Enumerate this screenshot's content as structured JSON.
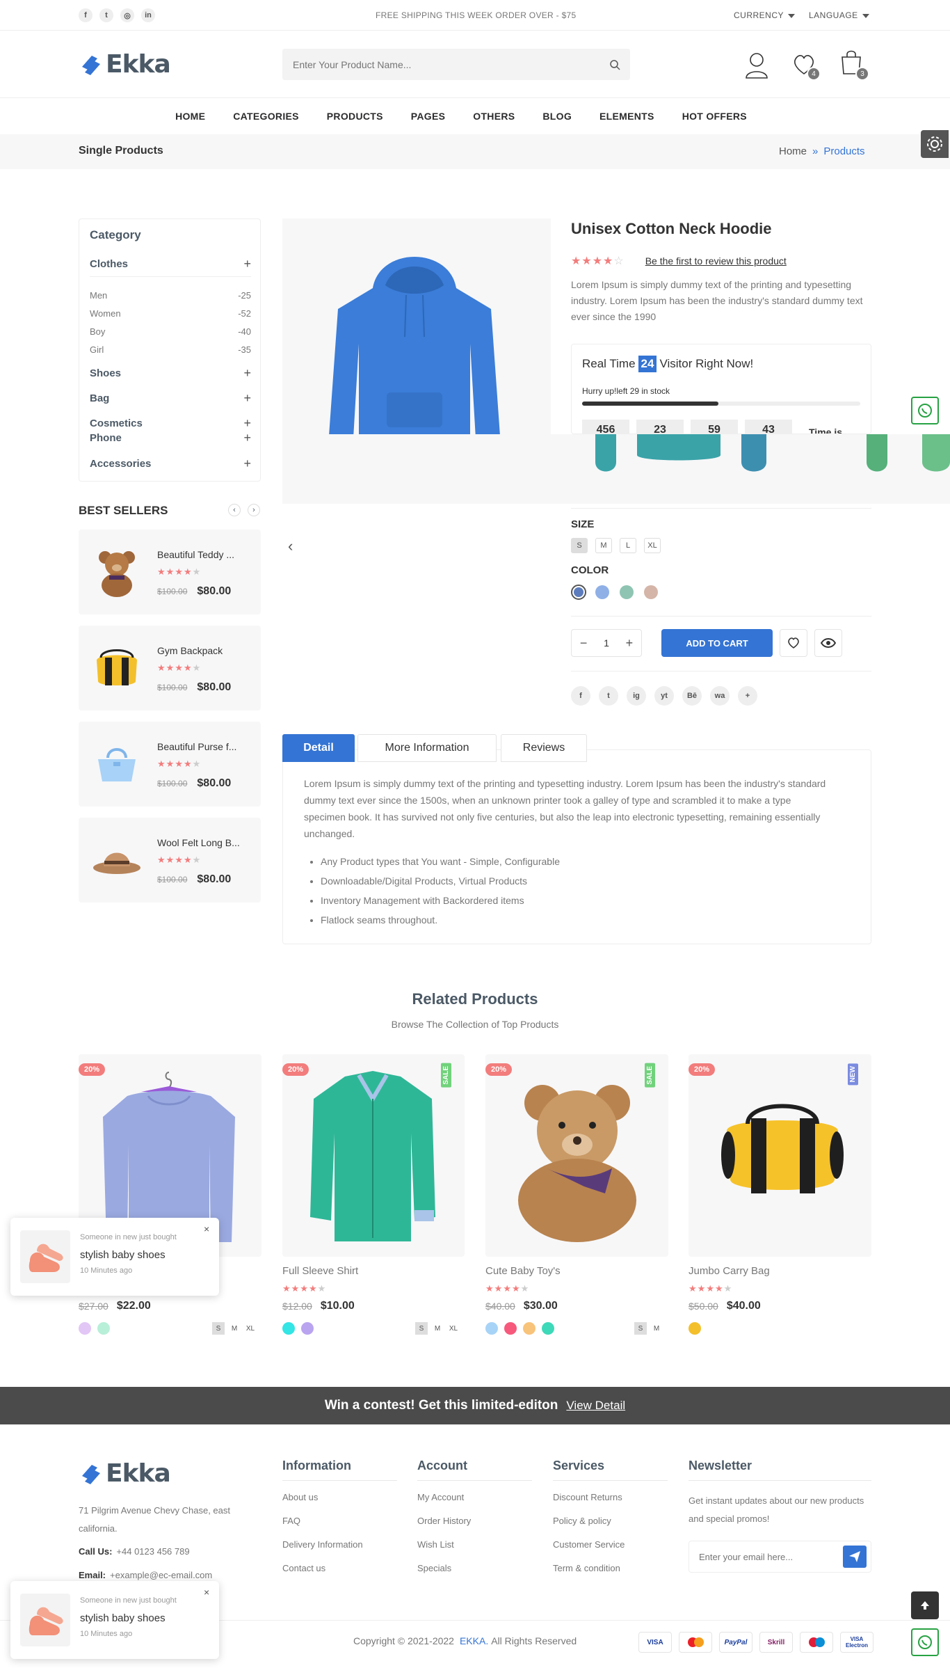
{
  "topbar": {
    "social_icons": [
      "facebook-icon",
      "twitter-icon",
      "instagram-icon",
      "linkedin-icon"
    ],
    "promo": "FREE SHIPPING THIS WEEK ORDER OVER - $75",
    "currency": "CURRENCY",
    "language": "LANGUAGE"
  },
  "header": {
    "logo": "Ekka",
    "search_placeholder": "Enter Your Product Name...",
    "wishlist_count": "4",
    "cart_count": "3"
  },
  "nav": [
    "HOME",
    "CATEGORIES",
    "PRODUCTS",
    "PAGES",
    "OTHERS",
    "BLOG",
    "ELEMENTS",
    "HOT OFFERS"
  ],
  "breadcrumb": {
    "title": "Single Products",
    "home": "Home",
    "current": "Products"
  },
  "sidebar": {
    "category_title": "Category",
    "clothes": "Clothes",
    "clothes_items": [
      {
        "name": "Men",
        "count": "-25"
      },
      {
        "name": "Women",
        "count": "-52"
      },
      {
        "name": "Boy",
        "count": "-40"
      },
      {
        "name": "Girl",
        "count": "-35"
      }
    ],
    "other_cats": [
      "Shoes",
      "Bag",
      "Cosmetics",
      "Phone",
      "Accessories"
    ],
    "best_sellers_title": "BEST SELLERS",
    "sellers": [
      {
        "name": "Beautiful Teddy ...",
        "old": "$100.00",
        "price": "$80.00"
      },
      {
        "name": "Gym Backpack",
        "old": "$100.00",
        "price": "$80.00"
      },
      {
        "name": "Beautiful Purse f...",
        "old": "$100.00",
        "price": "$80.00"
      },
      {
        "name": "Wool Felt Long B...",
        "old": "$100.00",
        "price": "$80.00"
      }
    ]
  },
  "product": {
    "title": "Unisex Cotton Neck Hoodie",
    "rating": 4,
    "review_link": "Be the first to review this product",
    "description": "Lorem Ipsum is simply dummy text of the printing and typesetting industry. Lorem Ipsum has been the industry's standard dummy text ever since the 1990",
    "visitor_pre": "Real Time",
    "visitor_count": "24",
    "visitor_post": "Visitor Right Now!",
    "stock_text": "Hurry up!left 29 in stock",
    "stock_fill": 0.49,
    "countdown": [
      "456",
      "23",
      "59",
      "43"
    ],
    "countdown_label": "Time is",
    "size_label": "SIZE",
    "sizes": [
      "S",
      "M",
      "L",
      "XL"
    ],
    "color_label": "COLOR",
    "colors": [
      "#5c7cbd",
      "#8fb0e6",
      "#8fc4b3",
      "#d4b5a8"
    ],
    "qty": "1",
    "add_to_cart": "ADD TO CART",
    "share_icons": [
      "f",
      "t",
      "ig",
      "yt",
      "Bē",
      "wa",
      "+"
    ]
  },
  "tabs": {
    "labels": [
      "Detail",
      "More Information",
      "Reviews"
    ],
    "body": "Lorem Ipsum is simply dummy text of the printing and typesetting industry. Lorem Ipsum has been the industry's standard dummy text ever since the 1500s, when an unknown printer took a galley of type and scrambled it to make a type specimen book. It has survived not only five centuries, but also the leap into electronic typesetting, remaining essentially unchanged.",
    "bullets": [
      "Any Product types that You want - Simple, Configurable",
      "Downloadable/Digital Products, Virtual Products",
      "Inventory Management with Backordered items",
      "Flatlock seams throughout."
    ]
  },
  "related": {
    "title": "Related Products",
    "subtitle": "Browse The Collection of Top Products",
    "items": [
      {
        "name": "",
        "discount": "20%",
        "tag": "",
        "old": "$27.00",
        "price": "$22.00",
        "colors": [
          "#e2c6f5",
          "#b8efd9"
        ],
        "sizes": [
          "S",
          "M",
          "XL"
        ]
      },
      {
        "name": "Full Sleeve Shirt",
        "discount": "20%",
        "tag": "SALE",
        "old": "$12.00",
        "price": "$10.00",
        "colors": [
          "#33e5e5",
          "#b9a4f0"
        ],
        "sizes": [
          "S",
          "M",
          "XL"
        ]
      },
      {
        "name": "Cute Baby Toy's",
        "discount": "20%",
        "tag": "SALE",
        "old": "$40.00",
        "price": "$30.00",
        "colors": [
          "#a7d3f7",
          "#f7597c",
          "#f8c37a",
          "#3ed9b9"
        ],
        "sizes": [
          "S",
          "M"
        ]
      },
      {
        "name": "Jumbo Carry Bag",
        "discount": "20%",
        "tag": "NEW",
        "old": "$50.00",
        "price": "$40.00",
        "colors": [
          "#f3c02c"
        ],
        "sizes": []
      }
    ]
  },
  "toast": {
    "title": "Someone in new just bought",
    "product": "stylish baby shoes",
    "time": "10 Minutes ago"
  },
  "cta": {
    "text": "Win a contest! Get this limited-editon",
    "link": "View Detail"
  },
  "footer": {
    "address": "71 Pilgrim Avenue Chevy Chase, east california.",
    "call_label": "Call Us:",
    "call": "+44 0123 456 789",
    "email_label": "Email:",
    "email": "+example@ec-email.com",
    "cols": [
      {
        "title": "Information",
        "links": [
          "About us",
          "FAQ",
          "Delivery Information",
          "Contact us"
        ]
      },
      {
        "title": "Account",
        "links": [
          "My Account",
          "Order History",
          "Wish List",
          "Specials"
        ]
      },
      {
        "title": "Services",
        "links": [
          "Discount Returns",
          "Policy & policy",
          "Customer Service",
          "Term & condition"
        ]
      }
    ],
    "newsletter_title": "Newsletter",
    "newsletter_text": "Get instant updates about our new products and special promos!",
    "newsletter_placeholder": "Enter your email here...",
    "copyright_pre": "Copyright © 2021-2022",
    "copyright_brand": "EKKA.",
    "copyright_post": "All Rights Reserved",
    "payments": [
      "VISA",
      "MC",
      "PayPal",
      "Skrill",
      "Maestro",
      "VISA Electron"
    ]
  },
  "accent": "#3474d4",
  "star_color": "#f27d7c"
}
